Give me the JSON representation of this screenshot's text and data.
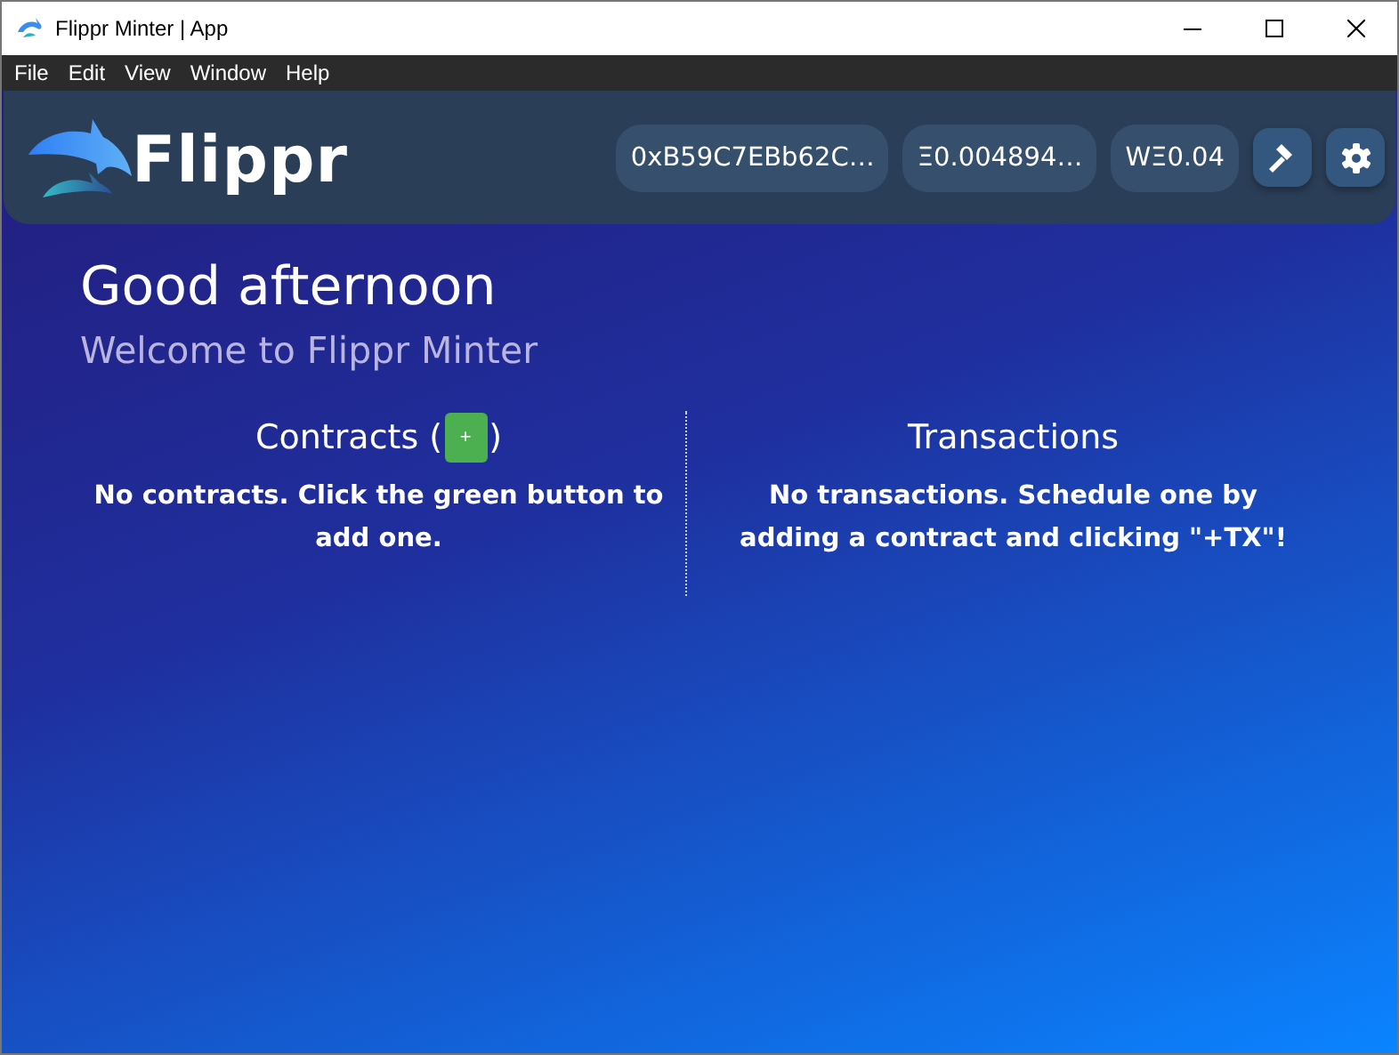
{
  "window": {
    "title": "Flippr Minter | App"
  },
  "menu": [
    "File",
    "Edit",
    "View",
    "Window",
    "Help"
  ],
  "header": {
    "brand": "Flippr",
    "chips": [
      "0xB59C7EBb62C…",
      "Ξ0.004894…",
      "WΞ0.04"
    ]
  },
  "greeting": "Good afternoon",
  "subtitle": "Welcome to Flippr Minter",
  "contracts": {
    "title": "Contracts (",
    "title_end": ")",
    "add": "+",
    "empty": "No contracts. Click the green button to add one."
  },
  "transactions": {
    "title": "Transactions",
    "empty": "No transactions. Schedule one by adding a contract and clicking \"+TX\"!"
  }
}
